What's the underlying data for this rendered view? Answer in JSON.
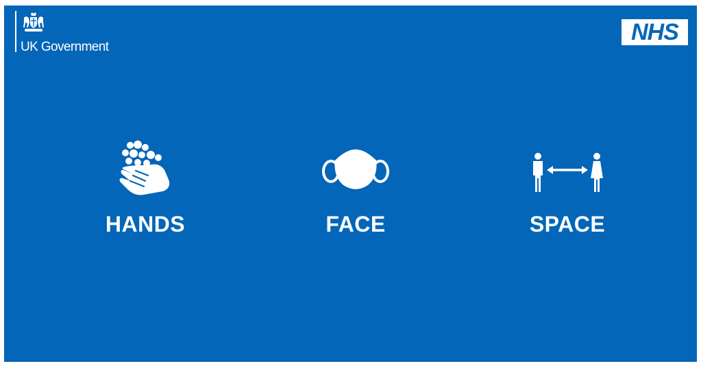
{
  "gov_logo": {
    "text": "UK Government",
    "icon": "royal-coat-of-arms"
  },
  "nhs_logo": {
    "text": "NHS"
  },
  "items": [
    {
      "label": "HANDS",
      "icon": "hand-washing-icon"
    },
    {
      "label": "FACE",
      "icon": "face-mask-icon"
    },
    {
      "label": "SPACE",
      "icon": "social-distance-icon"
    }
  ],
  "colors": {
    "background": "#0466b8",
    "foreground": "#ffffff",
    "nhs_blue": "#0466b8"
  }
}
